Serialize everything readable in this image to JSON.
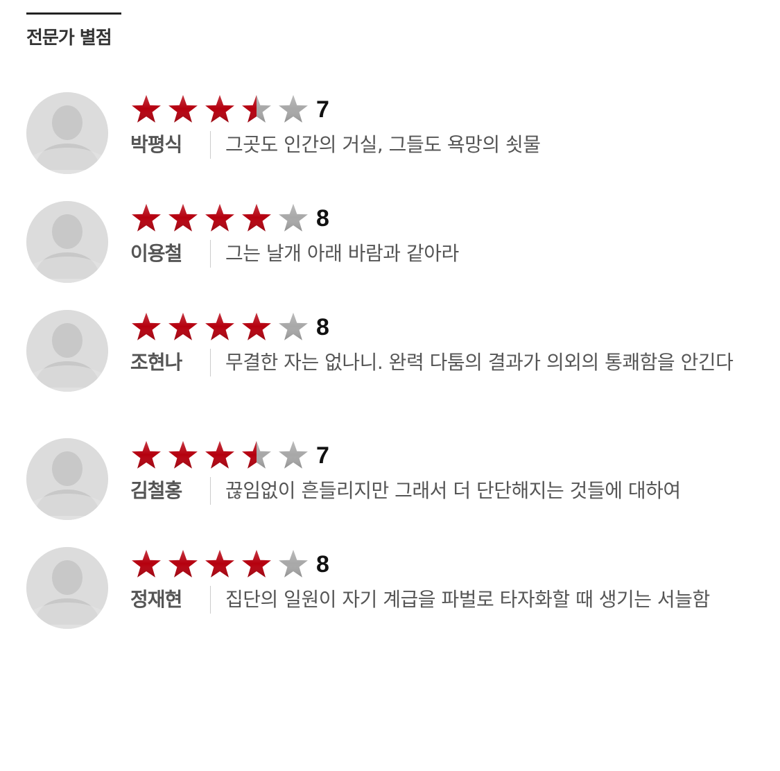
{
  "section": {
    "title": "전문가 별점"
  },
  "colors": {
    "star_filled": "#b5000e",
    "star_empty": "#a8a8a8",
    "avatar_bg": "#dcdcdc",
    "avatar_figure": "#c8c8c8"
  },
  "icons": {
    "avatar": "default-user-avatar-icon",
    "star": "star-icon"
  },
  "reviews": [
    {
      "name": "박평식",
      "score": "7",
      "stars": 3.5,
      "comment": "그곳도 인간의 거실, 그들도 욕망의 쇳물"
    },
    {
      "name": "이용철",
      "score": "8",
      "stars": 4,
      "comment": "그는 날개 아래 바람과 같아라"
    },
    {
      "name": "조현나",
      "score": "8",
      "stars": 4,
      "comment": "무결한 자는 없나니. 완력 다툼의 결과가 의외의 통쾌함을 안긴다"
    },
    {
      "name": "김철홍",
      "score": "7",
      "stars": 3.5,
      "comment": "끊임없이 흔들리지만 그래서 더 단단해지는 것들에 대하여"
    },
    {
      "name": "정재현",
      "score": "8",
      "stars": 4,
      "comment": "집단의 일원이 자기 계급을 파벌로 타자화할 때 생기는 서늘함"
    }
  ]
}
